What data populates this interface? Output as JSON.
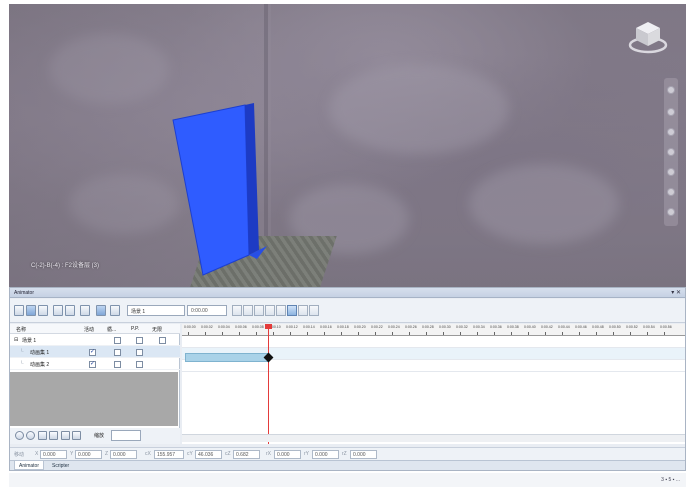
{
  "viewport": {
    "status_text": "C(-2)-B(-4) : F2设备层 (3)"
  },
  "animator": {
    "title": "Animator",
    "title_controls": "▾ ✕",
    "toolbar": {
      "scene_select": "场景 1",
      "time_input": "0:00.00"
    },
    "tree": {
      "headers": {
        "name": "名称",
        "active": "活动",
        "loop": "循...",
        "pp": "P.P.",
        "infinite": "无限"
      },
      "rows": [
        {
          "name": "场景 1",
          "active": false,
          "loop": false,
          "pp": false,
          "infinite": false
        },
        {
          "name": "动画集 1",
          "active": true,
          "loop": false,
          "pp": false
        },
        {
          "name": "动画集 2",
          "active": true,
          "loop": false,
          "pp": false
        }
      ],
      "zoom_label": "缩放"
    },
    "timeline": {
      "ticks": [
        "0:00.00",
        "0:00.02",
        "0:00.04",
        "0:00.06",
        "0:00.08",
        "0:00.10",
        "0:00.12",
        "0:00.14",
        "0:00.16",
        "0:00.18",
        "0:00.20",
        "0:00.22",
        "0:00.24",
        "0:00.26",
        "0:00.28",
        "0:00.30",
        "0:00.32",
        "0:00.34",
        "0:00.36",
        "0:00.38",
        "0:00.40",
        "0:00.42",
        "0:00.44",
        "0:00.46",
        "0:00.48",
        "0:00.50",
        "0:00.52",
        "0:00.54",
        "0:00.56"
      ],
      "playhead_fraction": 0.17,
      "keyframe_fraction": 0.17
    },
    "coords": {
      "label_move": "移动",
      "x_label": "X",
      "x": "0.000",
      "y_label": "Y",
      "y": "0.000",
      "z_label": "Z",
      "z": "0.000",
      "cx_label": "cX",
      "cx": "155.957",
      "cy_label": "cY",
      "cy": "46.036",
      "cz_label": "cZ",
      "cz": "0.682",
      "rx_label": "rX",
      "rx": "0.000",
      "ry_label": "rY",
      "ry": "0.000",
      "rz_label": "rZ",
      "rz": "0.000"
    },
    "tabs": [
      "Animator",
      "Scripter"
    ]
  },
  "statusbar": {
    "right_text": "3 ▪ 5 ▪ ..."
  },
  "colors": {
    "door": "#2f5cff",
    "playhead": "#e43b3b",
    "anim_bar": "#a9d2e8"
  }
}
